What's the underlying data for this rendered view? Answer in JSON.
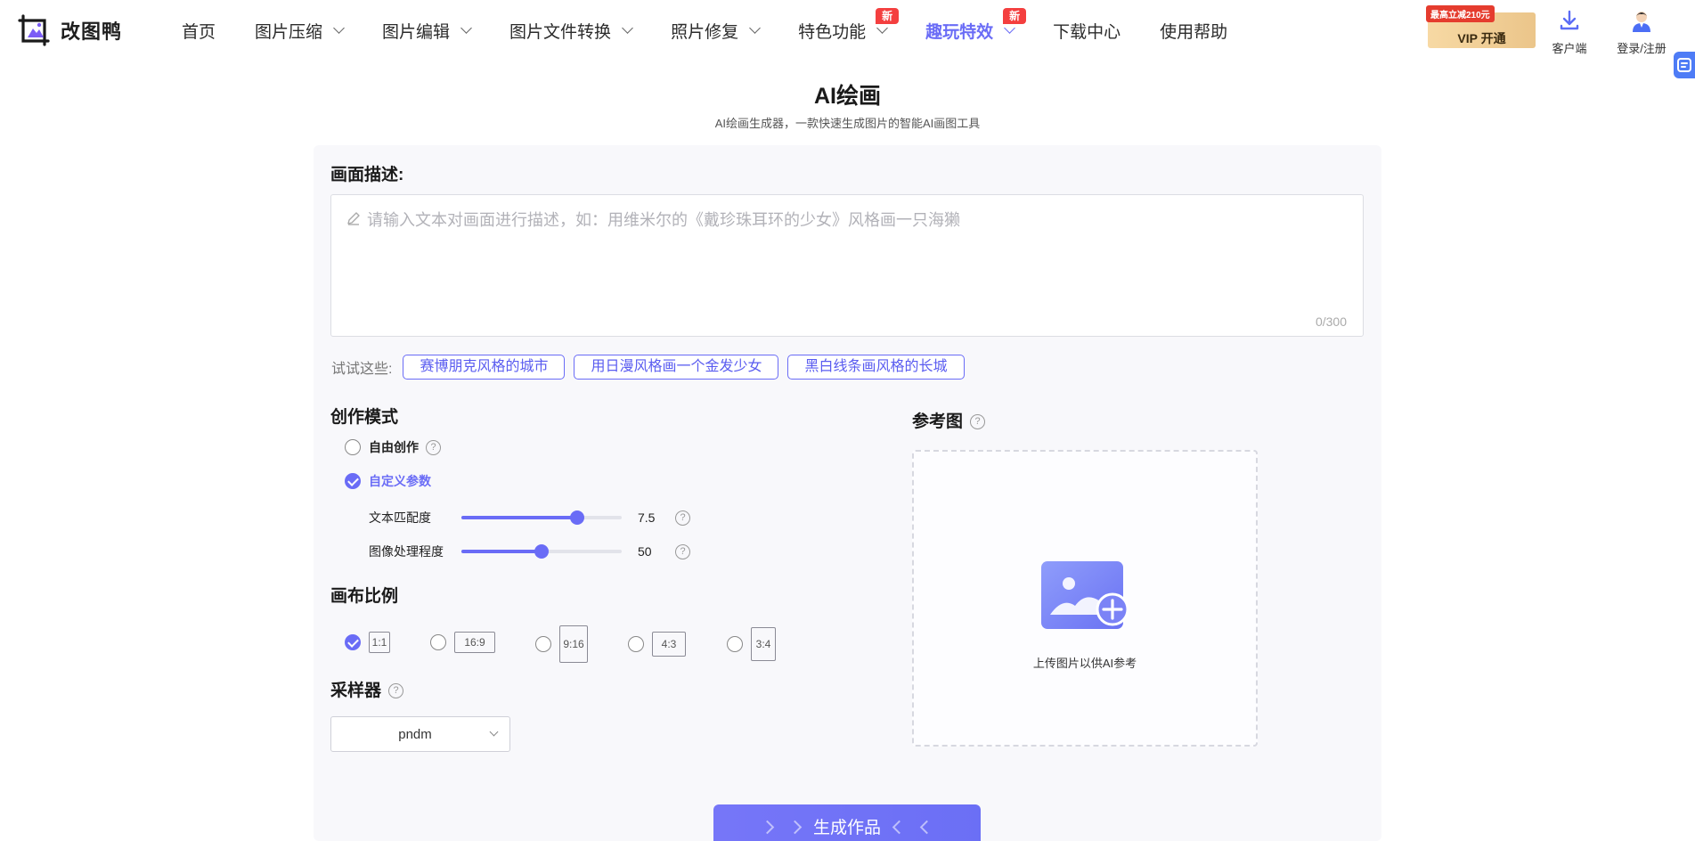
{
  "header": {
    "logo_text": "改图鸭",
    "nav": [
      {
        "label": "首页",
        "dropdown": false,
        "badge": "",
        "active": false
      },
      {
        "label": "图片压缩",
        "dropdown": true,
        "badge": "",
        "active": false
      },
      {
        "label": "图片编辑",
        "dropdown": true,
        "badge": "",
        "active": false
      },
      {
        "label": "图片文件转换",
        "dropdown": true,
        "badge": "",
        "active": false
      },
      {
        "label": "照片修复",
        "dropdown": true,
        "badge": "",
        "active": false
      },
      {
        "label": "特色功能",
        "dropdown": true,
        "badge": "新",
        "active": false
      },
      {
        "label": "趣玩特效",
        "dropdown": true,
        "badge": "新",
        "active": true
      },
      {
        "label": "下载中心",
        "dropdown": false,
        "badge": "",
        "active": false
      },
      {
        "label": "使用帮助",
        "dropdown": false,
        "badge": "",
        "active": false
      }
    ],
    "vip": {
      "badge": "最高立减210元",
      "label": "VIP 开通"
    },
    "client_label": "客户端",
    "login_label": "登录/注册"
  },
  "page": {
    "title": "AI绘画",
    "subtitle": "AI绘画生成器，一款快速生成图片的智能AI画图工具"
  },
  "prompt": {
    "heading": "画面描述:",
    "placeholder": "请输入文本对画面进行描述，如：用维米尔的《戴珍珠耳环的少女》风格画一只海獭",
    "value": "",
    "counter": "0/300"
  },
  "try": {
    "label": "试试这些:",
    "chips": [
      "赛博朋克风格的城市",
      "用日漫风格画一个金发少女",
      "黑白线条画风格的长城"
    ]
  },
  "mode": {
    "heading": "创作模式",
    "options": [
      {
        "label": "自由创作",
        "checked": false,
        "help": "?"
      },
      {
        "label": "自定义参数",
        "checked": true
      }
    ],
    "sliders": [
      {
        "label": "文本匹配度",
        "value": "7.5",
        "fraction": 0.72,
        "help": "?"
      },
      {
        "label": "图像处理程度",
        "value": "50",
        "fraction": 0.5,
        "help": "?"
      }
    ]
  },
  "ratio": {
    "heading": "画布比例",
    "options": [
      {
        "label": "1:1",
        "checked": true
      },
      {
        "label": "16:9",
        "checked": false
      },
      {
        "label": "9:16",
        "checked": false
      },
      {
        "label": "4:3",
        "checked": false
      },
      {
        "label": "3:4",
        "checked": false
      }
    ]
  },
  "sampler": {
    "heading": "采样器",
    "help": "?",
    "selected": "pndm"
  },
  "reference": {
    "heading": "参考图",
    "help": "?",
    "upload_text": "上传图片以供AI参考"
  },
  "generate_label": "生成作品",
  "colors": {
    "accent": "#6a6cf6",
    "badge_red": "#f43f3f",
    "vip_gold": "#f0cb8e"
  }
}
